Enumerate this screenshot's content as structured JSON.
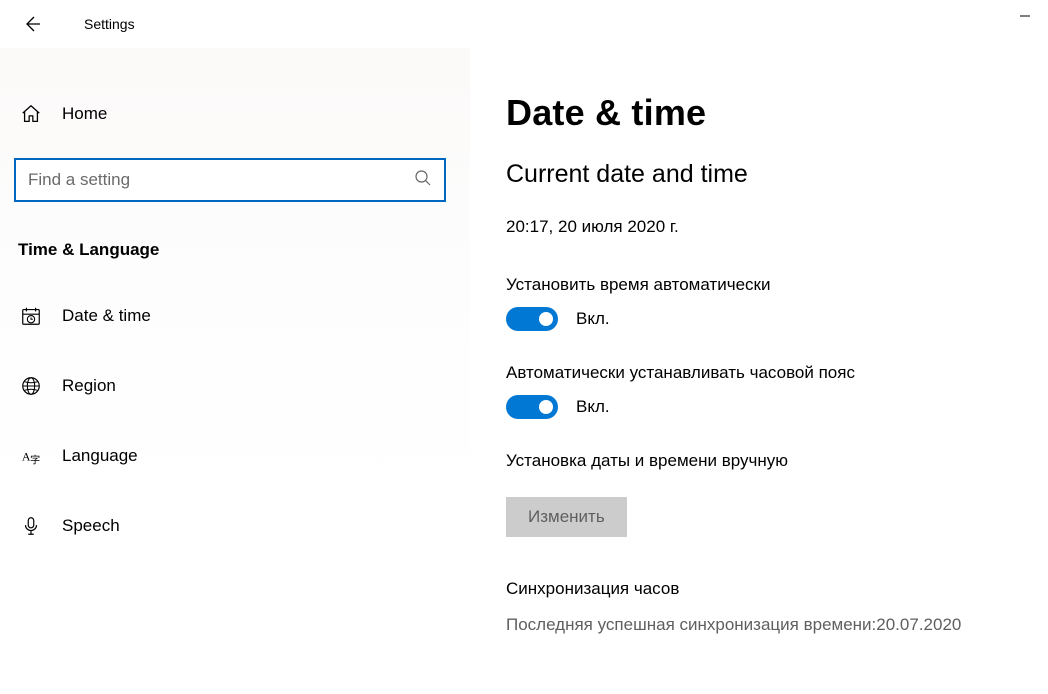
{
  "window": {
    "title": "Settings"
  },
  "sidebar": {
    "home_label": "Home",
    "search_placeholder": "Find a setting",
    "category": "Time & Language",
    "items": [
      {
        "label": "Date & time",
        "icon": "clock-calendar"
      },
      {
        "label": "Region",
        "icon": "globe"
      },
      {
        "label": "Language",
        "icon": "language"
      },
      {
        "label": "Speech",
        "icon": "microphone"
      }
    ]
  },
  "content": {
    "page_title": "Date & time",
    "section_title": "Current date and time",
    "current_datetime": "20:17, 20 июля 2020 г.",
    "auto_time": {
      "label": "Установить время автоматически",
      "state": "Вкл.",
      "on": true
    },
    "auto_tz": {
      "label": "Автоматически устанавливать часовой пояс",
      "state": "Вкл.",
      "on": true
    },
    "manual": {
      "label": "Установка даты и времени вручную",
      "button": "Изменить"
    },
    "sync": {
      "heading": "Синхронизация часов",
      "status": "Последняя успешная синхронизация времени:20.07.2020"
    }
  }
}
